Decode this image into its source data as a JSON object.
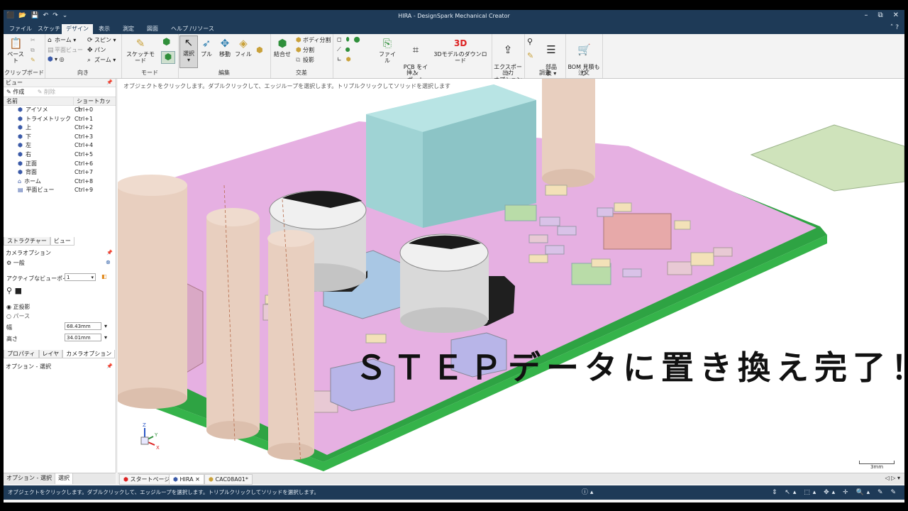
{
  "app": {
    "title": "HIRA - DesignSpark Mechanical Creator",
    "quick_access": [
      "⬛",
      "📂",
      "💾",
      "↶",
      "↷",
      "⌄"
    ],
    "window_controls": [
      "–",
      "⧉",
      "✕"
    ]
  },
  "menu": {
    "tabs": [
      "ファイル",
      "スケッチ",
      "デザイン",
      "表示",
      "測定",
      "図面",
      "ヘルプ /リソース"
    ],
    "active": "デザイン"
  },
  "ribbon": {
    "clipboard": {
      "label": "クリップボード",
      "paste": "ペースト"
    },
    "orient": {
      "label": "向き",
      "home": "ホーム",
      "spin": "スピン",
      "plan": "平面ビュー",
      "pan": "パン",
      "zoom": "ズーム"
    },
    "mode": {
      "label": "モード",
      "sketch": "スケッチモード"
    },
    "edit": {
      "label": "編集",
      "select": "選択",
      "pull": "プル",
      "move": "移動",
      "fill": "フィル"
    },
    "intersect": {
      "label": "交差",
      "combine": "結合せ",
      "split_body": "ボディ分割",
      "split": "分割",
      "project": "投影"
    },
    "insert": {
      "label": "挿入",
      "file": "ファイル",
      "pcb": "PCB をイン\nポート",
      "download_3d": "3Dモデルのダウンロード"
    },
    "output": {
      "label": "出力",
      "export": "エクスポート\nオプション"
    },
    "investigate": {
      "label": "調査",
      "parts": "部品\n表"
    },
    "order": {
      "label": "注文",
      "bom": "BOM 見積も\nり"
    }
  },
  "view_panel": {
    "header": "ビュー",
    "create": "作成",
    "delete": "削除",
    "col_name": "名前",
    "col_shortcut": "ショートカット",
    "items": [
      {
        "name": "アイソメ",
        "shortcut": "Ctrl+0"
      },
      {
        "name": "トライメトリック",
        "shortcut": "Ctrl+1"
      },
      {
        "name": "上",
        "shortcut": "Ctrl+2"
      },
      {
        "name": "下",
        "shortcut": "Ctrl+3"
      },
      {
        "name": "左",
        "shortcut": "Ctrl+4"
      },
      {
        "name": "右",
        "shortcut": "Ctrl+5"
      },
      {
        "name": "正面",
        "shortcut": "Ctrl+6"
      },
      {
        "name": "背面",
        "shortcut": "Ctrl+7"
      },
      {
        "name": "ホーム",
        "shortcut": "Ctrl+8"
      },
      {
        "name": "平面ビュー",
        "shortcut": "Ctrl+9"
      }
    ],
    "tabs": [
      "ストラクチャー",
      "ビュー"
    ]
  },
  "camera": {
    "header": "カメラオプション",
    "section": "一般",
    "active_viewpoint_label": "アクティブなビューポイント",
    "active_viewpoint_value": "1",
    "ortho": "正投影",
    "persp": "パース",
    "width_label": "幅",
    "width_value": "68.43mm",
    "height_label": "高さ",
    "height_value": "34.01mm",
    "tabs": [
      "プロパティ",
      "レイヤ",
      "カメラオプション"
    ],
    "options_header": "オプション - 選択"
  },
  "bottom_left_tabs": [
    "オプション - 選択",
    "選択"
  ],
  "canvas": {
    "hint": "オブジェクトをクリックします。ダブルクリックして、エッジループを選択します。トリプルクリックしてソリッドを選択します",
    "overlay": "ＳＴＥＰデータに置き換え完了！",
    "scale": "3mm"
  },
  "doc_tabs": [
    "スタートページ",
    "HIRA",
    "CAC08A01*"
  ],
  "status": {
    "message": "オブジェクトをクリックします。ダブルクリックして、エッジループを選択します。トリプルクリックしてソリッドを選択します。",
    "info": "ⓘ ▴",
    "tools": "⇕ ↖▴ ⬚▴ ✥▴ ✛ 🔍▴ ✎ ✎"
  },
  "colors": {
    "chrome": "#1e3a57",
    "pcb_top": "#e6b0e2",
    "pcb_edge": "#35b34a",
    "cylinder": "#e8cfbf"
  }
}
